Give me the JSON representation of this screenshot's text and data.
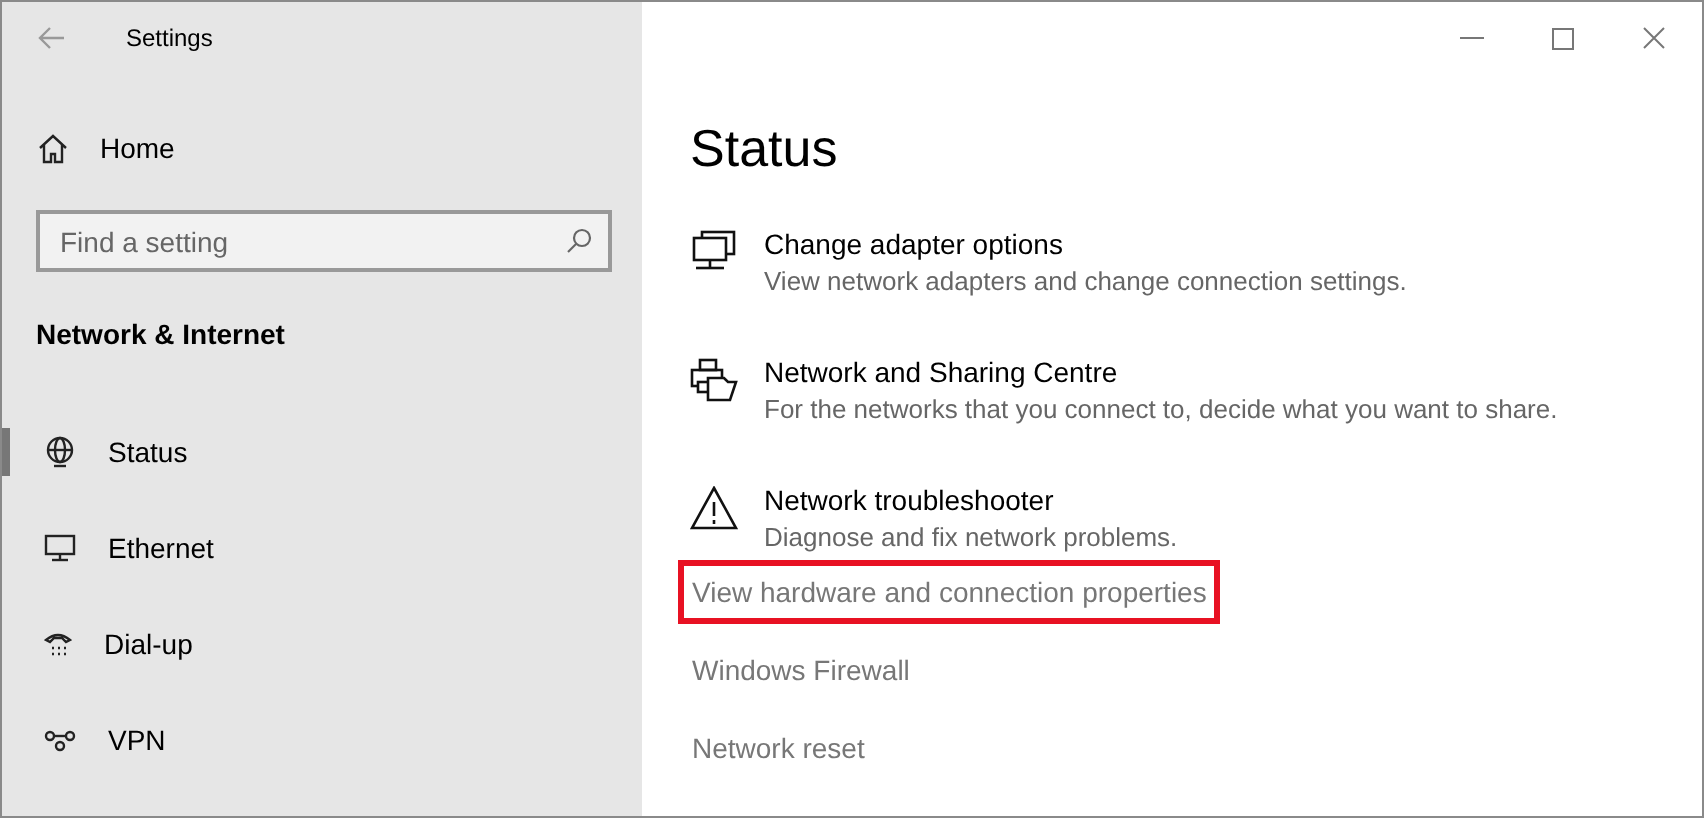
{
  "window": {
    "title": "Settings"
  },
  "sidebar": {
    "home": "Home",
    "search": {
      "placeholder": "Find a setting"
    },
    "section": "Network & Internet",
    "items": [
      {
        "label": "Status",
        "selected": true
      },
      {
        "label": "Ethernet",
        "selected": false
      },
      {
        "label": "Dial-up",
        "selected": false
      },
      {
        "label": "VPN",
        "selected": false
      }
    ]
  },
  "main": {
    "heading": "Status",
    "options": [
      {
        "title": "Change adapter options",
        "description": "View network adapters and change connection settings."
      },
      {
        "title": "Network and Sharing Centre",
        "description": "For the networks that you connect to, decide what you want to share."
      },
      {
        "title": "Network troubleshooter",
        "description": "Diagnose and fix network problems."
      }
    ],
    "links": [
      {
        "label": "View hardware and connection properties",
        "highlighted": true
      },
      {
        "label": "Windows Firewall",
        "highlighted": false
      },
      {
        "label": "Network reset",
        "highlighted": false
      }
    ]
  }
}
